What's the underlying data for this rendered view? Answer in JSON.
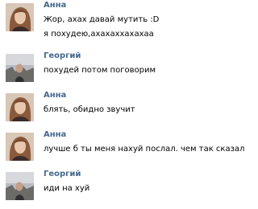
{
  "messages": [
    {
      "author": "Анна",
      "avatar": "anna-avatar",
      "lines": [
        "Жор, ахах давай мутить :D",
        "я похудею,ахахаххахахаа"
      ]
    },
    {
      "author": "Георгий",
      "avatar": "georgiy-avatar",
      "lines": [
        "похудей потом поговорим"
      ]
    },
    {
      "author": "Анна",
      "avatar": "anna-avatar",
      "lines": [
        "блять, обидно звучит"
      ]
    },
    {
      "author": "Анна",
      "avatar": "anna-avatar",
      "lines": [
        "лучше б ты меня нахуй послал. чем так сказал"
      ]
    },
    {
      "author": "Георгий",
      "avatar": "georgiy-avatar",
      "lines": [
        "иди на хуй"
      ]
    }
  ],
  "colors": {
    "author_name": "#45688e",
    "message_text": "#000000",
    "background": "#ffffff"
  }
}
